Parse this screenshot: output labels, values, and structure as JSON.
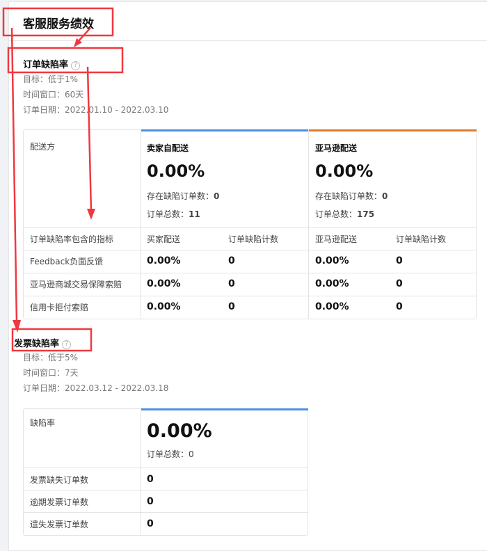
{
  "page_title": "客服服务绩效",
  "odr": {
    "title": "订单缺陷率",
    "help_icon": "question-circle-icon",
    "target": "目标：低于1%",
    "window": "时间窗口：60天",
    "dates": "订单日期：2022.01.10 - 2022.03.10",
    "col_label": "配送方",
    "seller": {
      "name": "卖家自配送",
      "rate": "0.00%",
      "defect_label": "存在缺陷订单数：",
      "defect": "0",
      "total_label": "订单总数：",
      "total": "11",
      "color": "#4a90e2"
    },
    "amazon": {
      "name": "亚马逊配送",
      "rate": "0.00%",
      "defect_label": "存在缺陷订单数：",
      "defect": "0",
      "total_label": "订单总数：",
      "total": "175",
      "color": "#e07b2e"
    },
    "headers": [
      "订单缺陷率包含的指标",
      "买家配送",
      "订单缺陷计数",
      "亚马逊配送",
      "订单缺陷计数"
    ],
    "rows": [
      [
        "Feedback负面反馈",
        "0.00%",
        "0",
        "0.00%",
        "0"
      ],
      [
        "亚马逊商城交易保障索赔",
        "0.00%",
        "0",
        "0.00%",
        "0"
      ],
      [
        "信用卡拒付索赔",
        "0.00%",
        "0",
        "0.00%",
        "0"
      ]
    ]
  },
  "invoice": {
    "title": "发票缺陷率",
    "target": "目标：低于5%",
    "window": "时间窗口：7天",
    "dates": "订单日期：2022.03.12 - 2022.03.18",
    "col_label": "缺陷率",
    "rate": "0.00%",
    "total": "订单总数：0",
    "rows": [
      [
        "发票缺失订单数",
        "0"
      ],
      [
        "逾期发票订单数",
        "0"
      ],
      [
        "遗失发票订单数",
        "0"
      ]
    ]
  }
}
